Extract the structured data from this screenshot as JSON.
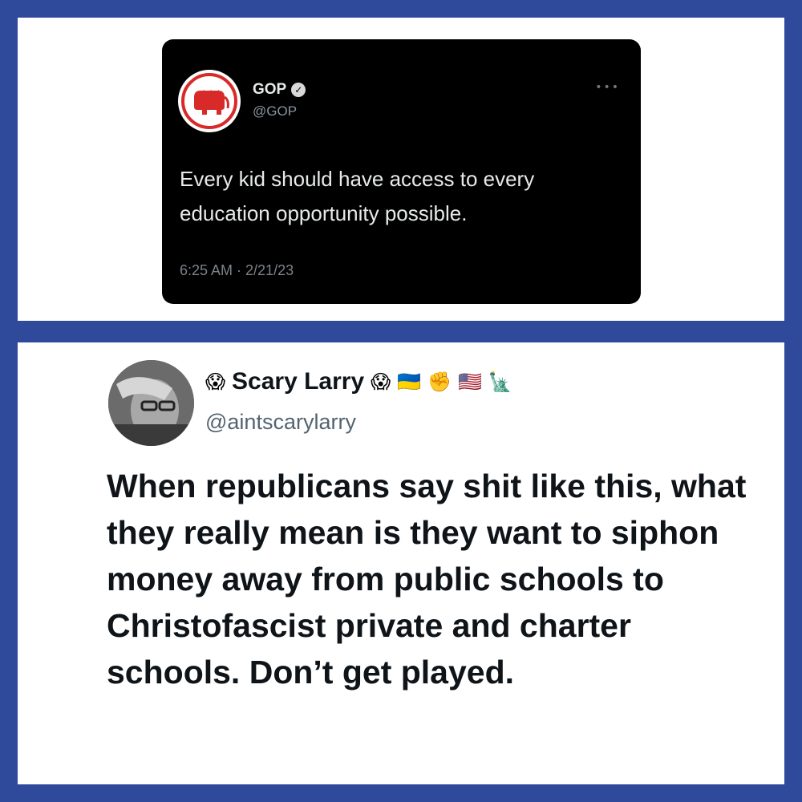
{
  "colors": {
    "frame": "#2f4a9b",
    "panel": "#ffffff",
    "dark_card": "#000000",
    "gop_red": "#d92a2a"
  },
  "gop_tweet": {
    "display_name": "GOP",
    "verified_icon": "verified-badge-icon",
    "handle": "@GOP",
    "more_icon": "more-options-icon",
    "more_glyph": "•••",
    "logo_icon": "republican-elephant-logo",
    "logo_stars": "★★★",
    "text": "Every kid should have access to every education opportunity possible.",
    "timestamp": "6:25 AM · 2/21/23"
  },
  "reply_tweet": {
    "name_prefix_emoji": "😱",
    "display_name": "Scary Larry",
    "name_suffix_emojis": [
      "😱",
      "🇺🇦",
      "✊",
      "🇺🇸",
      "🗽"
    ],
    "handle": "@aintscarylarry",
    "avatar_icon": "profile-photo-avatar",
    "text": "When republicans say shit like this, what they really mean is they want to siphon money away from public schools to Christofascist private and charter schools. Don’t get played."
  }
}
